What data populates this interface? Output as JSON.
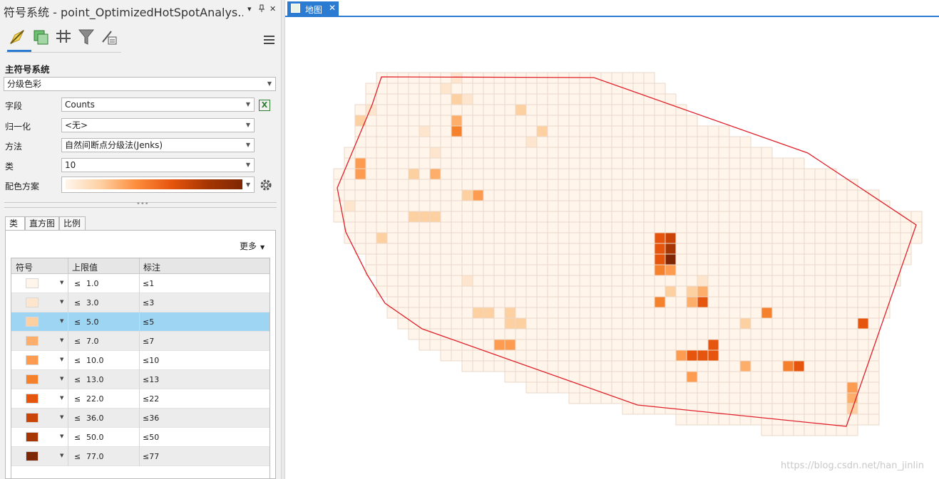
{
  "pane": {
    "title": "符号系统 - point_OptimizedHotSpotAnalys...",
    "controls": {
      "dropdown": "▾",
      "pin": "📌",
      "close": "✕"
    },
    "toolbar_icons": [
      "symbology-icon",
      "vary-symbology-icon",
      "labels-icon",
      "filter-icon",
      "advanced-icon"
    ],
    "primary_symbology_label": "主符号系统",
    "symbology_method": "分级色彩",
    "fields": {
      "field_label": "字段",
      "field_value": "Counts",
      "normalization_label": "归一化",
      "normalization_value": "<无>",
      "method_label": "方法",
      "method_value": "自然间断点分级法(Jenks)",
      "classes_label": "类",
      "classes_value": "10",
      "color_scheme_label": "配色方案"
    },
    "color_ramp": [
      "#fff5eb",
      "#fdd0a2",
      "#fd8d3c",
      "#e6550d",
      "#a63603",
      "#7f2704"
    ],
    "tabs": [
      "类",
      "直方图",
      "比例"
    ],
    "active_tab": 0,
    "more_label": "更多",
    "table": {
      "headers": [
        "符号",
        "上限值",
        "标注"
      ],
      "le_symbol": "≤",
      "rows": [
        {
          "color": "#fff5eb",
          "upper": "1.0",
          "label": "≤1"
        },
        {
          "color": "#fee6ce",
          "upper": "3.0",
          "label": "≤3"
        },
        {
          "color": "#fdd0a2",
          "upper": "5.0",
          "label": "≤5",
          "selected": true
        },
        {
          "color": "#fdae6b",
          "upper": "7.0",
          "label": "≤7"
        },
        {
          "color": "#fd9c51",
          "upper": "10.0",
          "label": "≤10"
        },
        {
          "color": "#f6812c",
          "upper": "13.0",
          "label": "≤13"
        },
        {
          "color": "#e6550d",
          "upper": "22.0",
          "label": "≤22"
        },
        {
          "color": "#c94406",
          "upper": "36.0",
          "label": "≤36"
        },
        {
          "color": "#a63603",
          "upper": "50.0",
          "label": "≤50"
        },
        {
          "color": "#7f2704",
          "upper": "77.0",
          "label": "≤77"
        }
      ]
    }
  },
  "map": {
    "tab_label": "地图",
    "tab_close": "✕",
    "boundary_color": "#e0202a",
    "grid_line_color": "#ead8c8",
    "hotspot_cells": [
      {
        "c": 11,
        "r": 0,
        "cls": 1
      },
      {
        "c": 10,
        "r": 1,
        "cls": 1
      },
      {
        "c": 11,
        "r": 2,
        "cls": 2
      },
      {
        "c": 12,
        "r": 2,
        "cls": 1
      },
      {
        "c": 3,
        "r": 3,
        "cls": 1
      },
      {
        "c": 17,
        "r": 3,
        "cls": 2
      },
      {
        "c": 2,
        "r": 4,
        "cls": 2
      },
      {
        "c": 11,
        "r": 4,
        "cls": 3
      },
      {
        "c": 11,
        "r": 5,
        "cls": 5
      },
      {
        "c": 8,
        "r": 5,
        "cls": 1
      },
      {
        "c": 19,
        "r": 5,
        "cls": 2
      },
      {
        "c": 18,
        "r": 6,
        "cls": 1
      },
      {
        "c": 9,
        "r": 7,
        "cls": 1
      },
      {
        "c": 2,
        "r": 8,
        "cls": 4
      },
      {
        "c": 2,
        "r": 9,
        "cls": 4
      },
      {
        "c": 7,
        "r": 9,
        "cls": 2
      },
      {
        "c": 9,
        "r": 9,
        "cls": 3
      },
      {
        "c": 12,
        "r": 11,
        "cls": 2
      },
      {
        "c": 13,
        "r": 11,
        "cls": 4
      },
      {
        "c": 1,
        "r": 12,
        "cls": 1
      },
      {
        "c": 7,
        "r": 13,
        "cls": 2
      },
      {
        "c": 8,
        "r": 13,
        "cls": 2
      },
      {
        "c": 9,
        "r": 13,
        "cls": 2
      },
      {
        "c": 4,
        "r": 15,
        "cls": 2
      },
      {
        "c": 30,
        "r": 15,
        "cls": 6
      },
      {
        "c": 31,
        "r": 15,
        "cls": 7
      },
      {
        "c": 30,
        "r": 16,
        "cls": 6
      },
      {
        "c": 31,
        "r": 16,
        "cls": 8
      },
      {
        "c": 30,
        "r": 17,
        "cls": 6
      },
      {
        "c": 31,
        "r": 17,
        "cls": 9
      },
      {
        "c": 30,
        "r": 18,
        "cls": 5
      },
      {
        "c": 31,
        "r": 18,
        "cls": 4
      },
      {
        "c": 12,
        "r": 19,
        "cls": 1
      },
      {
        "c": 34,
        "r": 19,
        "cls": 1
      },
      {
        "c": 31,
        "r": 20,
        "cls": 2
      },
      {
        "c": 33,
        "r": 20,
        "cls": 2
      },
      {
        "c": 34,
        "r": 20,
        "cls": 3
      },
      {
        "c": 30,
        "r": 21,
        "cls": 5
      },
      {
        "c": 33,
        "r": 21,
        "cls": 3
      },
      {
        "c": 34,
        "r": 21,
        "cls": 6
      },
      {
        "c": 40,
        "r": 22,
        "cls": 5
      },
      {
        "c": 13,
        "r": 22,
        "cls": 2
      },
      {
        "c": 14,
        "r": 22,
        "cls": 2
      },
      {
        "c": 16,
        "r": 22,
        "cls": 2
      },
      {
        "c": 49,
        "r": 23,
        "cls": 6
      },
      {
        "c": 16,
        "r": 23,
        "cls": 2
      },
      {
        "c": 17,
        "r": 23,
        "cls": 2
      },
      {
        "c": 38,
        "r": 23,
        "cls": 2
      },
      {
        "c": 15,
        "r": 25,
        "cls": 4
      },
      {
        "c": 16,
        "r": 25,
        "cls": 4
      },
      {
        "c": 35,
        "r": 25,
        "cls": 6
      },
      {
        "c": 32,
        "r": 26,
        "cls": 4
      },
      {
        "c": 33,
        "r": 26,
        "cls": 6
      },
      {
        "c": 34,
        "r": 26,
        "cls": 6
      },
      {
        "c": 35,
        "r": 26,
        "cls": 6
      },
      {
        "c": 38,
        "r": 27,
        "cls": 3
      },
      {
        "c": 42,
        "r": 27,
        "cls": 5
      },
      {
        "c": 43,
        "r": 27,
        "cls": 6
      },
      {
        "c": 33,
        "r": 28,
        "cls": 4
      },
      {
        "c": 48,
        "r": 29,
        "cls": 4
      },
      {
        "c": 48,
        "r": 30,
        "cls": 3
      },
      {
        "c": 48,
        "r": 31,
        "cls": 2
      }
    ]
  },
  "watermark": "https://blog.csdn.net/han_jinlin"
}
